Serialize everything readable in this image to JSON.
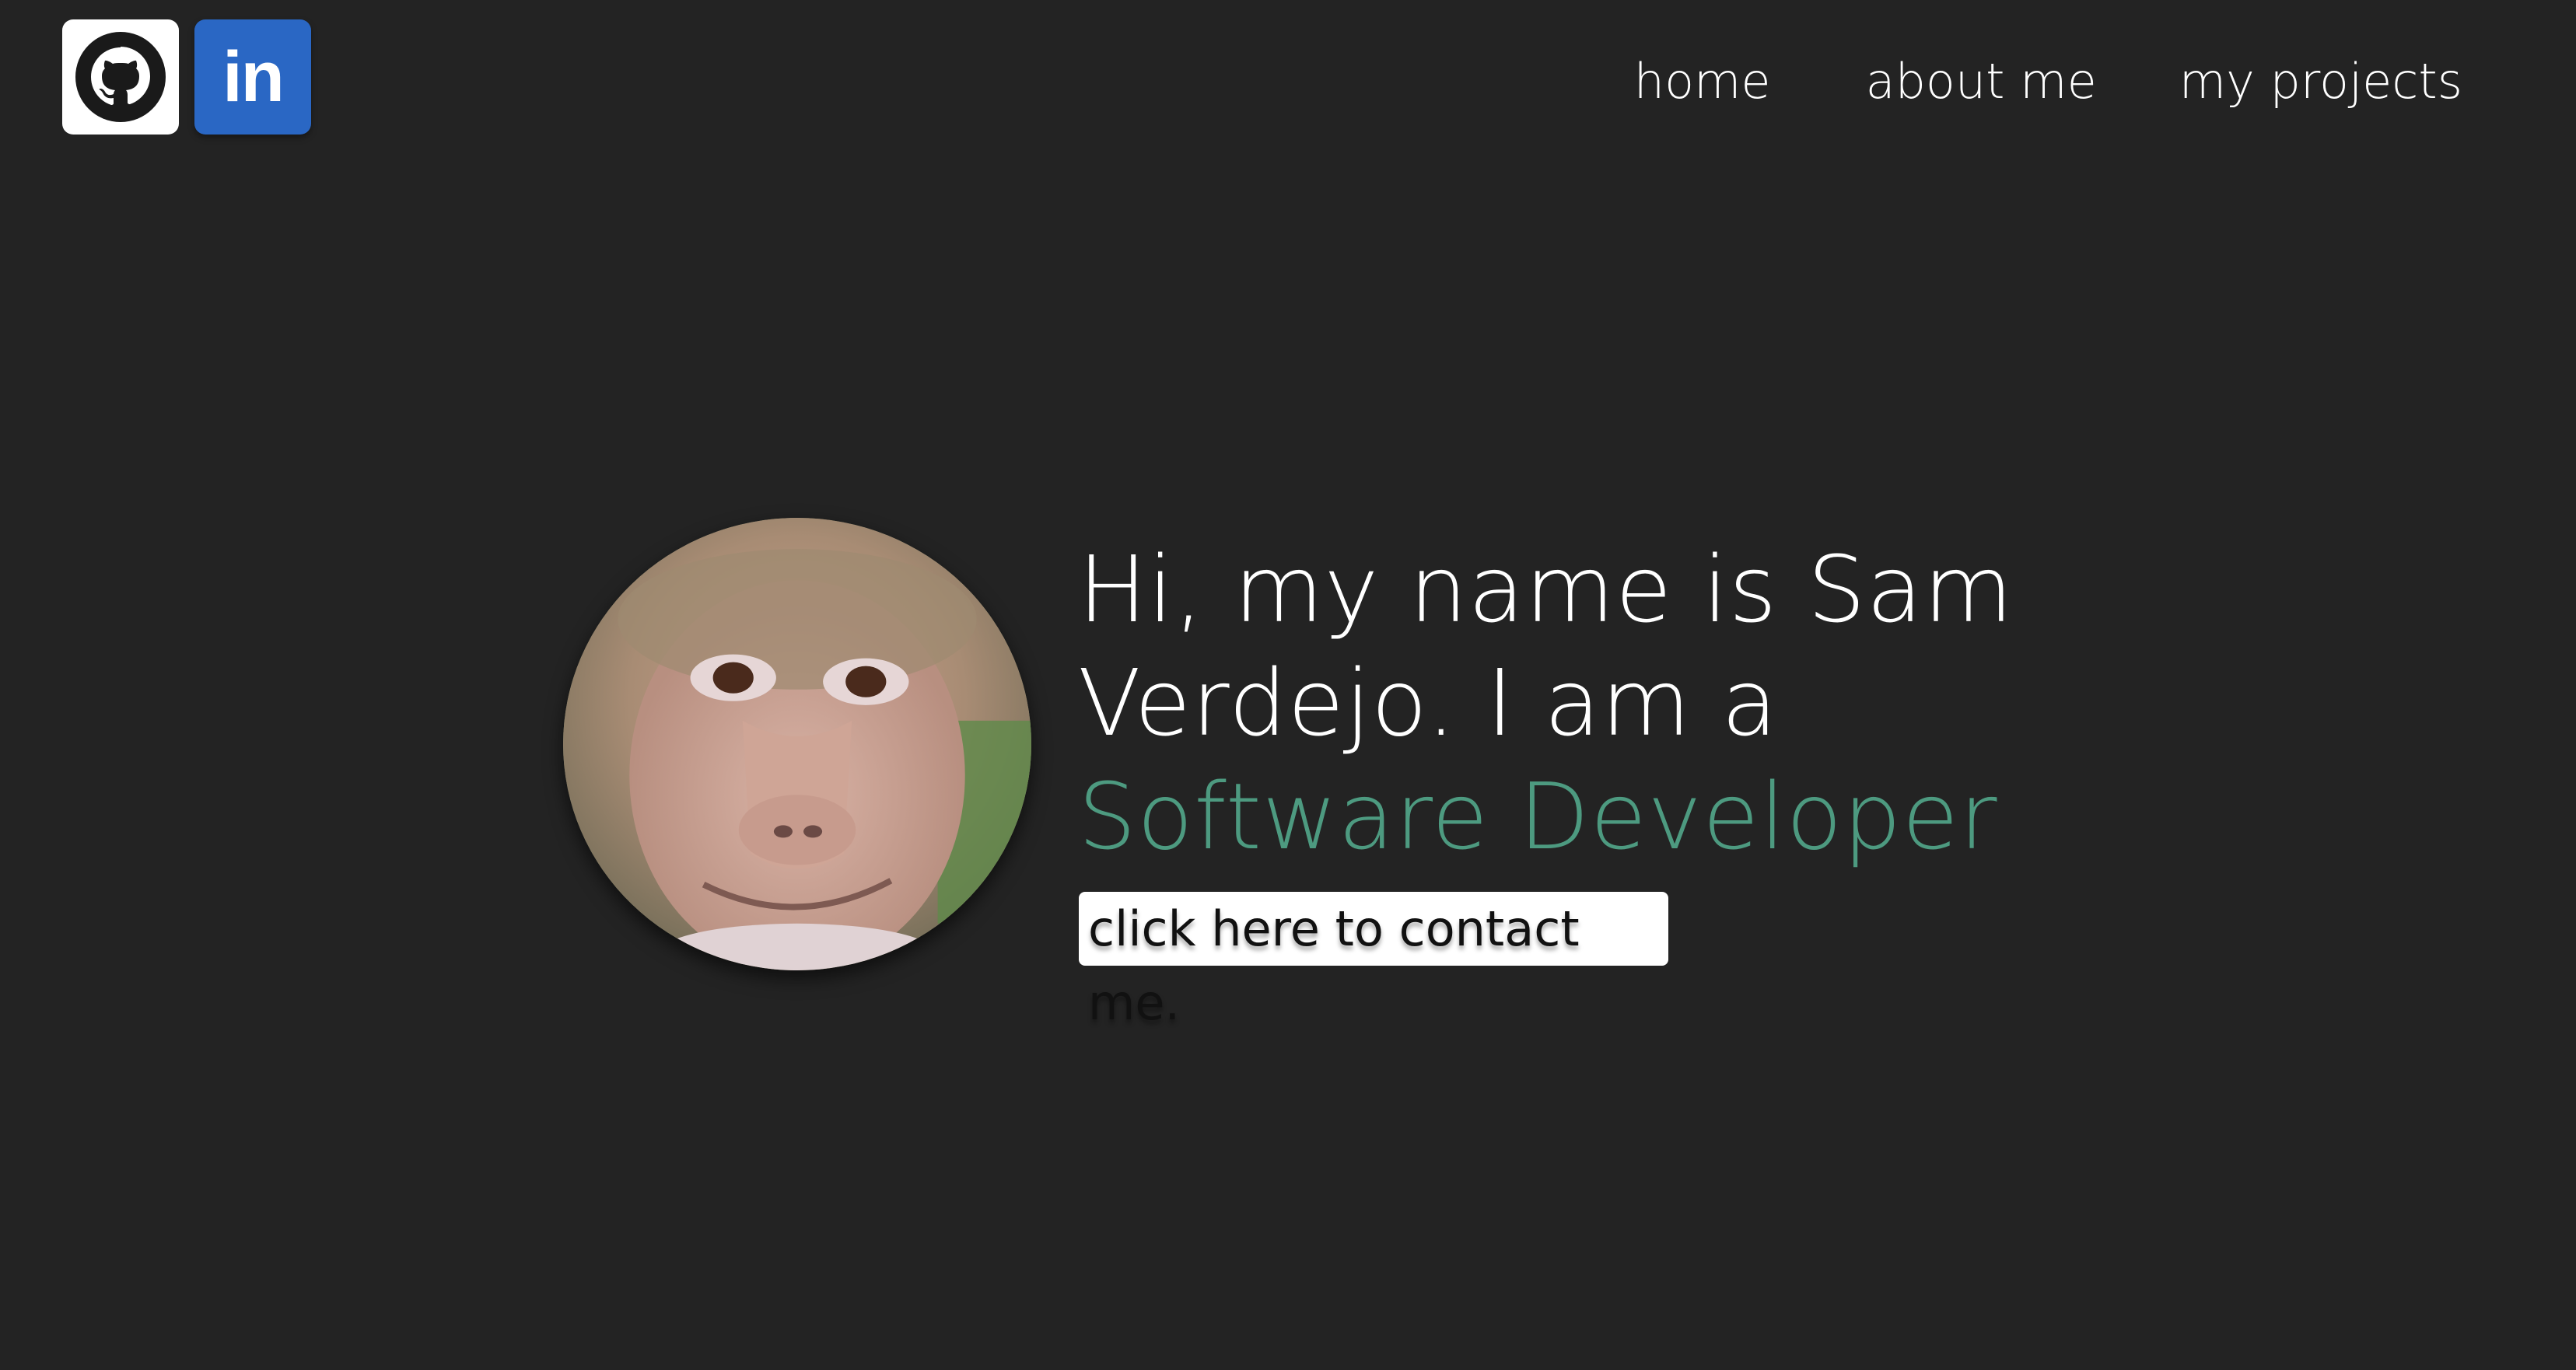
{
  "social": {
    "github": {
      "icon": "github-icon"
    },
    "linkedin": {
      "icon": "linkedin-icon",
      "label": "in"
    }
  },
  "nav": {
    "home": "home",
    "about": "about me",
    "projects": "my projects"
  },
  "hero": {
    "line1": "Hi, my name is Sam",
    "line2": "Verdejo. I am a",
    "role": "Software Developer",
    "contact_label": "click here to contact me.",
    "accent_color": "#4d9a80"
  },
  "colors": {
    "background": "#232323",
    "linkedin_blue": "#2a67c4"
  }
}
